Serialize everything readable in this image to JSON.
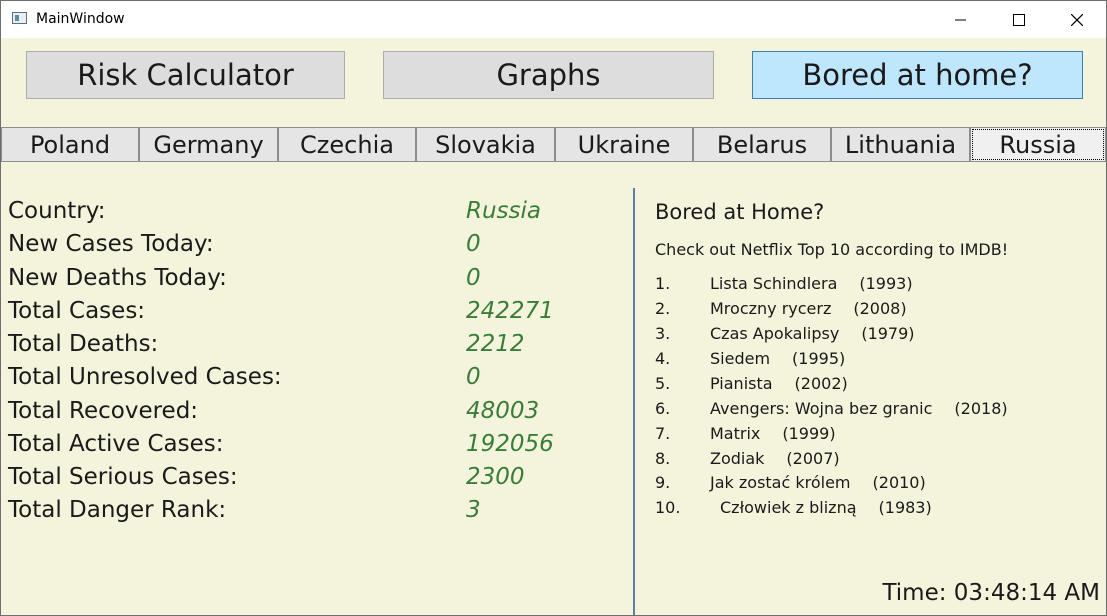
{
  "window": {
    "title": "MainWindow"
  },
  "toolbar": {
    "risk_label": "Risk Calculator",
    "graphs_label": "Graphs",
    "bored_label": "Bored at home?"
  },
  "tabs": [
    {
      "label": "Poland"
    },
    {
      "label": "Germany"
    },
    {
      "label": "Czechia"
    },
    {
      "label": "Slovakia"
    },
    {
      "label": "Ukraine"
    },
    {
      "label": "Belarus"
    },
    {
      "label": "Lithuania"
    },
    {
      "label": "Russia"
    }
  ],
  "selected_tab": "Russia",
  "stats": [
    {
      "label": "Country:",
      "value": "Russia"
    },
    {
      "label": "New Cases Today:",
      "value": "0"
    },
    {
      "label": "New Deaths Today:",
      "value": "0"
    },
    {
      "label": "Total Cases:",
      "value": "242271"
    },
    {
      "label": "Total Deaths:",
      "value": "2212"
    },
    {
      "label": "Total Unresolved Cases:",
      "value": "0"
    },
    {
      "label": "Total Recovered:",
      "value": "48003"
    },
    {
      "label": "Total Active Cases:",
      "value": "192056"
    },
    {
      "label": "Total Serious Cases:",
      "value": "2300"
    },
    {
      "label": "Total Danger Rank:",
      "value": "3"
    }
  ],
  "bored": {
    "title": "Bored at Home?",
    "subtitle": "Check out Netflix Top 10 according to IMDB!",
    "movies": [
      {
        "num": "1.",
        "title": "Lista Schindlera",
        "year": "(1993)"
      },
      {
        "num": "2.",
        "title": "Mroczny rycerz",
        "year": "(2008)"
      },
      {
        "num": "3.",
        "title": "Czas Apokalipsy",
        "year": "(1979)"
      },
      {
        "num": "4.",
        "title": "Siedem",
        "year": "(1995)"
      },
      {
        "num": "5.",
        "title": "Pianista",
        "year": "(2002)"
      },
      {
        "num": "6.",
        "title": "Avengers: Wojna bez granic",
        "year": "(2018)"
      },
      {
        "num": "7.",
        "title": "Matrix",
        "year": "(1999)"
      },
      {
        "num": "8.",
        "title": "Zodiak",
        "year": "(2007)"
      },
      {
        "num": "9.",
        "title": "Jak zostać królem",
        "year": "(2010)"
      },
      {
        "num": "10.",
        "title": "Człowiek z blizną",
        "year": "(1983)"
      }
    ]
  },
  "clock": {
    "text": "Time: 03:48:14 AM"
  },
  "colors": {
    "background": "#f4f4dc",
    "value_text": "#3a7d3a",
    "accent_button": "#bee6fd",
    "divider": "#5b7fa6"
  }
}
